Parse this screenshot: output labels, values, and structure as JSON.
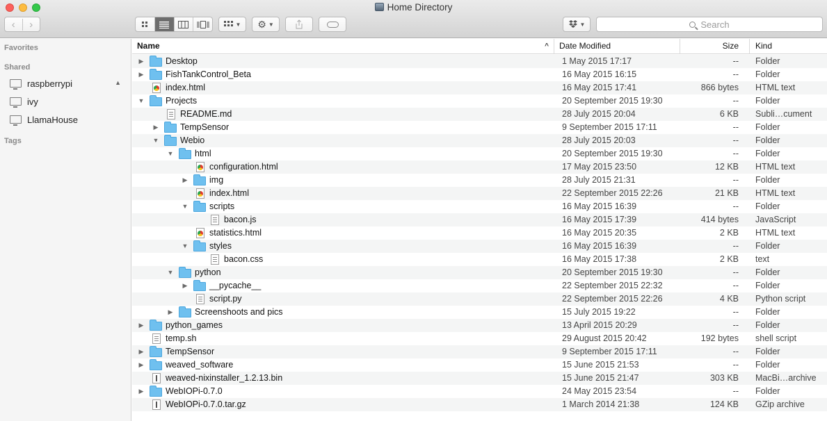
{
  "window": {
    "title": "Home Directory"
  },
  "toolbar": {
    "back": "‹",
    "forward": "›",
    "search_placeholder": "Search"
  },
  "sidebar": {
    "sections": {
      "favorites": "Favorites",
      "shared": "Shared",
      "tags": "Tags"
    },
    "shared_items": [
      {
        "label": "raspberrypi",
        "ejectable": true
      },
      {
        "label": "ivy"
      },
      {
        "label": "LlamaHouse"
      }
    ]
  },
  "columns": {
    "name": "Name",
    "date": "Date Modified",
    "size": "Size",
    "kind": "Kind"
  },
  "files": [
    {
      "depth": 0,
      "expander": "collapsed",
      "icon": "folder",
      "name": "Desktop",
      "date": "1 May 2015 17:17",
      "size": "--",
      "kind": "Folder"
    },
    {
      "depth": 0,
      "expander": "collapsed",
      "icon": "folder",
      "name": "FishTankControl_Beta",
      "date": "16 May 2015 16:15",
      "size": "--",
      "kind": "Folder"
    },
    {
      "depth": 0,
      "expander": "none",
      "icon": "html",
      "name": "index.html",
      "date": "16 May 2015 17:41",
      "size": "866 bytes",
      "kind": "HTML text"
    },
    {
      "depth": 0,
      "expander": "expanded",
      "icon": "folder",
      "name": "Projects",
      "date": "20 September 2015 19:30",
      "size": "--",
      "kind": "Folder"
    },
    {
      "depth": 1,
      "expander": "none",
      "icon": "doc",
      "name": "README.md",
      "date": "28 July 2015 20:04",
      "size": "6 KB",
      "kind": "Subli…cument"
    },
    {
      "depth": 1,
      "expander": "collapsed",
      "icon": "folder",
      "name": "TempSensor",
      "date": "9 September 2015 17:11",
      "size": "--",
      "kind": "Folder"
    },
    {
      "depth": 1,
      "expander": "expanded",
      "icon": "folder",
      "name": "Webio",
      "date": "28 July 2015 20:03",
      "size": "--",
      "kind": "Folder"
    },
    {
      "depth": 2,
      "expander": "expanded",
      "icon": "folder",
      "name": "html",
      "date": "20 September 2015 19:30",
      "size": "--",
      "kind": "Folder"
    },
    {
      "depth": 3,
      "expander": "none",
      "icon": "html",
      "name": "configuration.html",
      "date": "17 May 2015 23:50",
      "size": "12 KB",
      "kind": "HTML text"
    },
    {
      "depth": 3,
      "expander": "collapsed",
      "icon": "folder",
      "name": "img",
      "date": "28 July 2015 21:31",
      "size": "--",
      "kind": "Folder"
    },
    {
      "depth": 3,
      "expander": "none",
      "icon": "html",
      "name": "index.html",
      "date": "22 September 2015 22:26",
      "size": "21 KB",
      "kind": "HTML text"
    },
    {
      "depth": 3,
      "expander": "expanded",
      "icon": "folder",
      "name": "scripts",
      "date": "16 May 2015 16:39",
      "size": "--",
      "kind": "Folder"
    },
    {
      "depth": 4,
      "expander": "none",
      "icon": "doc",
      "name": "bacon.js",
      "date": "16 May 2015 17:39",
      "size": "414 bytes",
      "kind": "JavaScript"
    },
    {
      "depth": 3,
      "expander": "none",
      "icon": "html",
      "name": "statistics.html",
      "date": "16 May 2015 20:35",
      "size": "2 KB",
      "kind": "HTML text"
    },
    {
      "depth": 3,
      "expander": "expanded",
      "icon": "folder",
      "name": "styles",
      "date": "16 May 2015 16:39",
      "size": "--",
      "kind": "Folder"
    },
    {
      "depth": 4,
      "expander": "none",
      "icon": "doc",
      "name": "bacon.css",
      "date": "16 May 2015 17:38",
      "size": "2 KB",
      "kind": "text"
    },
    {
      "depth": 2,
      "expander": "expanded",
      "icon": "folder",
      "name": "python",
      "date": "20 September 2015 19:30",
      "size": "--",
      "kind": "Folder"
    },
    {
      "depth": 3,
      "expander": "collapsed",
      "icon": "folder",
      "name": "__pycache__",
      "date": "22 September 2015 22:32",
      "size": "--",
      "kind": "Folder"
    },
    {
      "depth": 3,
      "expander": "none",
      "icon": "doc",
      "name": "script.py",
      "date": "22 September 2015 22:26",
      "size": "4 KB",
      "kind": "Python script"
    },
    {
      "depth": 2,
      "expander": "collapsed",
      "icon": "folder",
      "name": "Screenshoots and pics",
      "date": "15 July 2015 19:22",
      "size": "--",
      "kind": "Folder"
    },
    {
      "depth": 0,
      "expander": "collapsed",
      "icon": "folder",
      "name": "python_games",
      "date": "13 April 2015 20:29",
      "size": "--",
      "kind": "Folder"
    },
    {
      "depth": 0,
      "expander": "none",
      "icon": "doc",
      "name": "temp.sh",
      "date": "29 August 2015 20:42",
      "size": "192 bytes",
      "kind": "shell script"
    },
    {
      "depth": 0,
      "expander": "collapsed",
      "icon": "folder",
      "name": "TempSensor",
      "date": "9 September 2015 17:11",
      "size": "--",
      "kind": "Folder"
    },
    {
      "depth": 0,
      "expander": "collapsed",
      "icon": "folder",
      "name": "weaved_software",
      "date": "15 June 2015 21:53",
      "size": "--",
      "kind": "Folder"
    },
    {
      "depth": 0,
      "expander": "none",
      "icon": "bin",
      "name": "weaved-nixinstaller_1.2.13.bin",
      "date": "15 June 2015 21:47",
      "size": "303 KB",
      "kind": "MacBi…archive"
    },
    {
      "depth": 0,
      "expander": "collapsed",
      "icon": "folder",
      "name": "WebIOPi-0.7.0",
      "date": "24 May 2015 23:54",
      "size": "--",
      "kind": "Folder"
    },
    {
      "depth": 0,
      "expander": "none",
      "icon": "bin",
      "name": "WebIOPi-0.7.0.tar.gz",
      "date": "1 March 2014 21:38",
      "size": "124 KB",
      "kind": "GZip archive"
    }
  ]
}
